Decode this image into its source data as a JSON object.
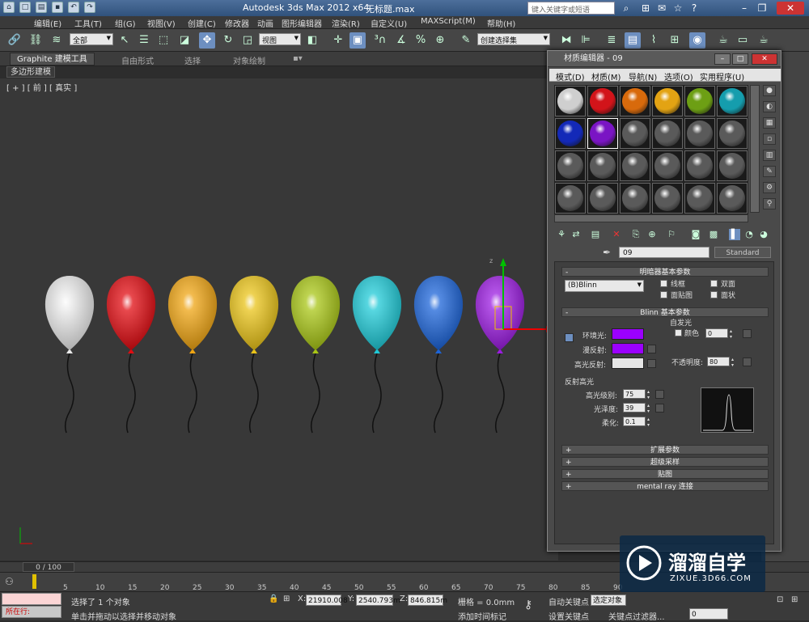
{
  "app": {
    "title": "Autodesk 3ds Max  2012 x64",
    "file": "无标题.max",
    "search_placeholder": "键入关键字或短语"
  },
  "menu": [
    "编辑(E)",
    "工具(T)",
    "组(G)",
    "视图(V)",
    "创建(C)",
    "修改器",
    "动画",
    "图形编辑器",
    "渲染(R)",
    "自定义(U)",
    "MAXScript(M)",
    "帮助(H)"
  ],
  "toolbar": {
    "filter": "全部",
    "refcoord": "视图",
    "named_sel": "创建选择集"
  },
  "ribbon": {
    "tabs": [
      "Graphite 建模工具",
      "自由形式",
      "选择",
      "对象绘制"
    ],
    "subtab": "多边形建模"
  },
  "viewport": {
    "label": "[ + ] [ 前 ] [ 真实 ]"
  },
  "balloons": [
    "#e9e9e9",
    "#e00c12",
    "#eea413",
    "#e9c319",
    "#a8c516",
    "#1fc9d6",
    "#1c64d8",
    "#9b1ce0"
  ],
  "mated": {
    "title": "材质编辑器 - 09",
    "menu": [
      "模式(D)",
      "材质(M)",
      "导航(N)",
      "选项(O)",
      "实用程序(U)"
    ],
    "slot_colors": [
      "#cfcfcf",
      "#d2141a",
      "#d86a0c",
      "#e3a313",
      "#6d9f14",
      "#159dad",
      "#1329b8",
      "#7a15c4"
    ],
    "mat_name": "09",
    "mat_type": "Standard",
    "roll_shader": "明暗器基本参数",
    "shader": "(B)Blinn",
    "shader_opts": [
      "线框",
      "双面",
      "面贴图",
      "面状"
    ],
    "roll_blinn": "Blinn 基本参数",
    "self_illum": "自发光",
    "color_lbl": "颜色",
    "self_illum_val": "0",
    "ambient": "环境光:",
    "diffuse": "漫反射:",
    "specular": "高光反射:",
    "ambient_color": "#9b00ff",
    "diffuse_color": "#9b00ff",
    "specular_color": "#e6e6e6",
    "opacity_lbl": "不透明度:",
    "opacity": "80",
    "spec_hl": "反射高光",
    "spec_level_lbl": "高光级别:",
    "spec_level": "75",
    "gloss_lbl": "光泽度:",
    "gloss": "39",
    "soften_lbl": "柔化:",
    "soften": "0.1",
    "rollouts": [
      "扩展参数",
      "超级采样",
      "贴图",
      "mental ray 连接"
    ]
  },
  "timeline": {
    "frame": "0 / 100",
    "ticks": [
      "0",
      "5",
      "10",
      "15",
      "20",
      "25",
      "30",
      "35",
      "40",
      "45",
      "50",
      "55",
      "60",
      "65",
      "70",
      "75",
      "80",
      "85",
      "90"
    ]
  },
  "status": {
    "selected": "选择了 1 个对象",
    "hint": "单击并拖动以选择并移动对象",
    "x": "21910.008",
    "y": "2540.793m",
    "z": "846.815m",
    "grid": "栅格 = 0.0mm",
    "auto_key": "自动关键点",
    "set_key": "设置关键点",
    "sel_obj": "选定对象",
    "key_filter": "关键点过滤器...",
    "add_time_tag": "添加时间标记",
    "listener": "所在行:",
    "frame_field": "0"
  },
  "watermark": {
    "name": "溜溜自学",
    "url": "ZIXUE.3D66.COM"
  }
}
